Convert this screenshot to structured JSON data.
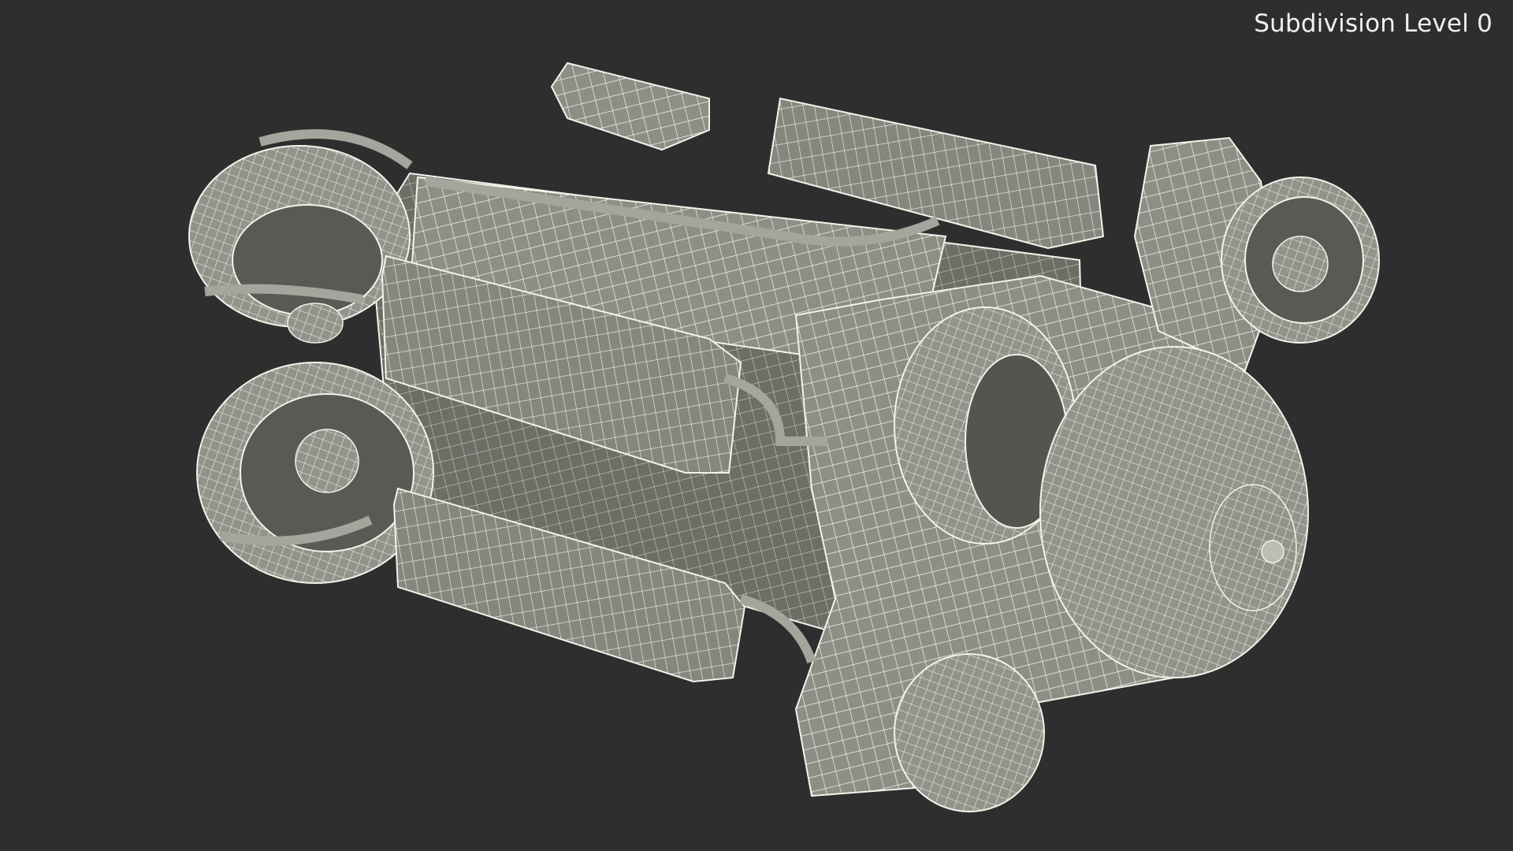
{
  "viewport": {
    "overlay_label": "Subdivision Level 0",
    "background_color": "#2e2e2e",
    "model": {
      "description_name": "rov-wireframe-model",
      "surface_color": "#8f8f87",
      "wire_color": "#f2f2ea"
    }
  }
}
